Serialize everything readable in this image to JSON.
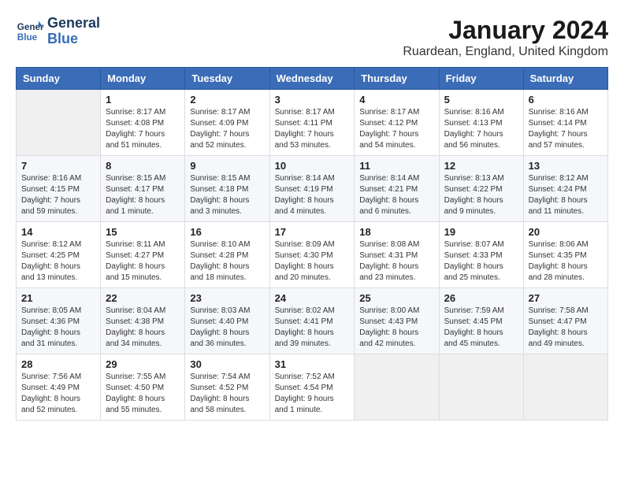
{
  "logo": {
    "line1": "General",
    "line2": "Blue"
  },
  "title": "January 2024",
  "location": "Ruardean, England, United Kingdom",
  "days_of_week": [
    "Sunday",
    "Monday",
    "Tuesday",
    "Wednesday",
    "Thursday",
    "Friday",
    "Saturday"
  ],
  "weeks": [
    [
      {
        "day": "",
        "info": ""
      },
      {
        "day": "1",
        "info": "Sunrise: 8:17 AM\nSunset: 4:08 PM\nDaylight: 7 hours\nand 51 minutes."
      },
      {
        "day": "2",
        "info": "Sunrise: 8:17 AM\nSunset: 4:09 PM\nDaylight: 7 hours\nand 52 minutes."
      },
      {
        "day": "3",
        "info": "Sunrise: 8:17 AM\nSunset: 4:11 PM\nDaylight: 7 hours\nand 53 minutes."
      },
      {
        "day": "4",
        "info": "Sunrise: 8:17 AM\nSunset: 4:12 PM\nDaylight: 7 hours\nand 54 minutes."
      },
      {
        "day": "5",
        "info": "Sunrise: 8:16 AM\nSunset: 4:13 PM\nDaylight: 7 hours\nand 56 minutes."
      },
      {
        "day": "6",
        "info": "Sunrise: 8:16 AM\nSunset: 4:14 PM\nDaylight: 7 hours\nand 57 minutes."
      }
    ],
    [
      {
        "day": "7",
        "info": "Sunrise: 8:16 AM\nSunset: 4:15 PM\nDaylight: 7 hours\nand 59 minutes."
      },
      {
        "day": "8",
        "info": "Sunrise: 8:15 AM\nSunset: 4:17 PM\nDaylight: 8 hours\nand 1 minute."
      },
      {
        "day": "9",
        "info": "Sunrise: 8:15 AM\nSunset: 4:18 PM\nDaylight: 8 hours\nand 3 minutes."
      },
      {
        "day": "10",
        "info": "Sunrise: 8:14 AM\nSunset: 4:19 PM\nDaylight: 8 hours\nand 4 minutes."
      },
      {
        "day": "11",
        "info": "Sunrise: 8:14 AM\nSunset: 4:21 PM\nDaylight: 8 hours\nand 6 minutes."
      },
      {
        "day": "12",
        "info": "Sunrise: 8:13 AM\nSunset: 4:22 PM\nDaylight: 8 hours\nand 9 minutes."
      },
      {
        "day": "13",
        "info": "Sunrise: 8:12 AM\nSunset: 4:24 PM\nDaylight: 8 hours\nand 11 minutes."
      }
    ],
    [
      {
        "day": "14",
        "info": "Sunrise: 8:12 AM\nSunset: 4:25 PM\nDaylight: 8 hours\nand 13 minutes."
      },
      {
        "day": "15",
        "info": "Sunrise: 8:11 AM\nSunset: 4:27 PM\nDaylight: 8 hours\nand 15 minutes."
      },
      {
        "day": "16",
        "info": "Sunrise: 8:10 AM\nSunset: 4:28 PM\nDaylight: 8 hours\nand 18 minutes."
      },
      {
        "day": "17",
        "info": "Sunrise: 8:09 AM\nSunset: 4:30 PM\nDaylight: 8 hours\nand 20 minutes."
      },
      {
        "day": "18",
        "info": "Sunrise: 8:08 AM\nSunset: 4:31 PM\nDaylight: 8 hours\nand 23 minutes."
      },
      {
        "day": "19",
        "info": "Sunrise: 8:07 AM\nSunset: 4:33 PM\nDaylight: 8 hours\nand 25 minutes."
      },
      {
        "day": "20",
        "info": "Sunrise: 8:06 AM\nSunset: 4:35 PM\nDaylight: 8 hours\nand 28 minutes."
      }
    ],
    [
      {
        "day": "21",
        "info": "Sunrise: 8:05 AM\nSunset: 4:36 PM\nDaylight: 8 hours\nand 31 minutes."
      },
      {
        "day": "22",
        "info": "Sunrise: 8:04 AM\nSunset: 4:38 PM\nDaylight: 8 hours\nand 34 minutes."
      },
      {
        "day": "23",
        "info": "Sunrise: 8:03 AM\nSunset: 4:40 PM\nDaylight: 8 hours\nand 36 minutes."
      },
      {
        "day": "24",
        "info": "Sunrise: 8:02 AM\nSunset: 4:41 PM\nDaylight: 8 hours\nand 39 minutes."
      },
      {
        "day": "25",
        "info": "Sunrise: 8:00 AM\nSunset: 4:43 PM\nDaylight: 8 hours\nand 42 minutes."
      },
      {
        "day": "26",
        "info": "Sunrise: 7:59 AM\nSunset: 4:45 PM\nDaylight: 8 hours\nand 45 minutes."
      },
      {
        "day": "27",
        "info": "Sunrise: 7:58 AM\nSunset: 4:47 PM\nDaylight: 8 hours\nand 49 minutes."
      }
    ],
    [
      {
        "day": "28",
        "info": "Sunrise: 7:56 AM\nSunset: 4:49 PM\nDaylight: 8 hours\nand 52 minutes."
      },
      {
        "day": "29",
        "info": "Sunrise: 7:55 AM\nSunset: 4:50 PM\nDaylight: 8 hours\nand 55 minutes."
      },
      {
        "day": "30",
        "info": "Sunrise: 7:54 AM\nSunset: 4:52 PM\nDaylight: 8 hours\nand 58 minutes."
      },
      {
        "day": "31",
        "info": "Sunrise: 7:52 AM\nSunset: 4:54 PM\nDaylight: 9 hours\nand 1 minute."
      },
      {
        "day": "",
        "info": ""
      },
      {
        "day": "",
        "info": ""
      },
      {
        "day": "",
        "info": ""
      }
    ]
  ]
}
